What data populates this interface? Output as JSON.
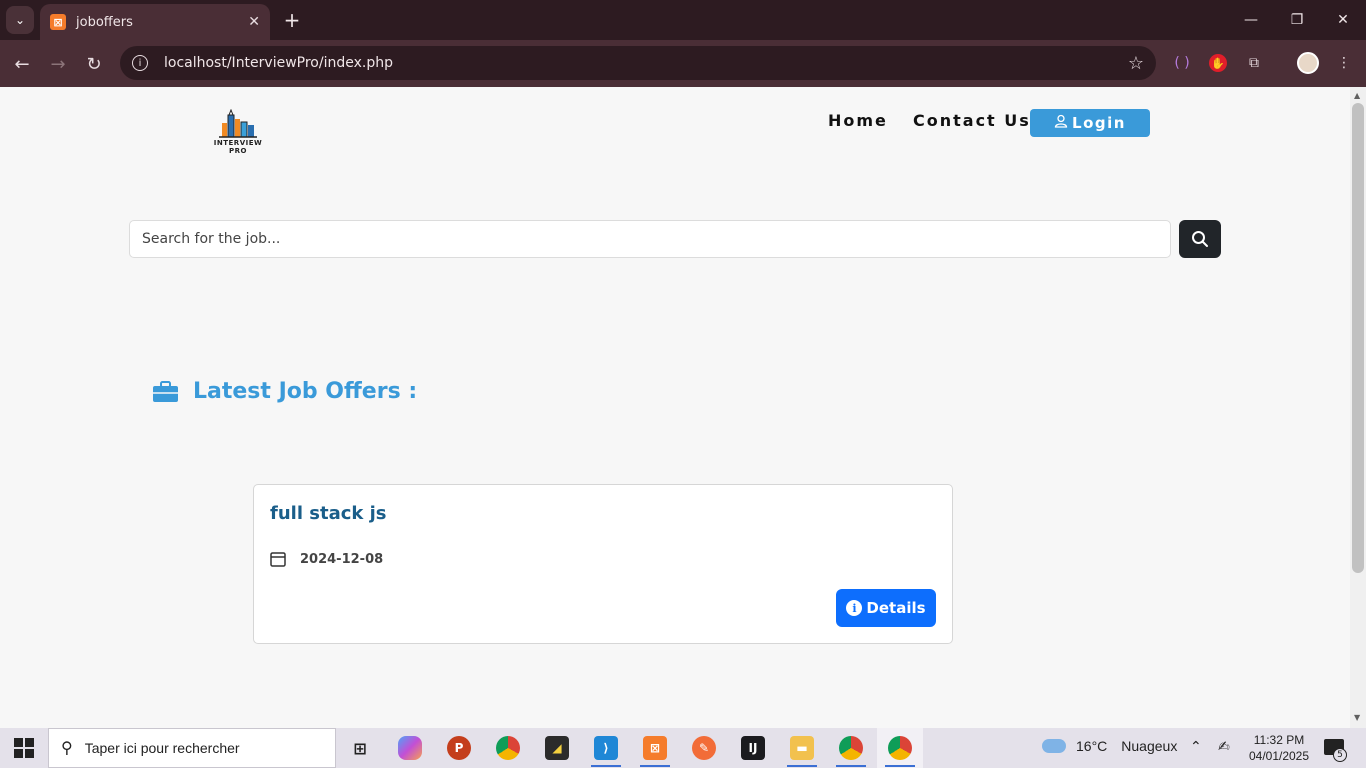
{
  "browser": {
    "tab_title": "joboffers",
    "url": "localhost/InterviewPro/index.php",
    "new_tab_label": "+",
    "close_tab_label": "✕"
  },
  "site": {
    "logo_text": "INTERVIEW PRO",
    "nav": {
      "home": "Home",
      "contact": "Contact Us",
      "login": "Login"
    },
    "search": {
      "placeholder": "Search for the job..."
    },
    "section_title": "Latest Job Offers :",
    "jobs": [
      {
        "title": "full stack js",
        "date": "2024-12-08",
        "details_label": "Details"
      }
    ],
    "colors": {
      "accent": "#3a9ad9",
      "details_button": "#0d6efd",
      "search_button": "#212529",
      "job_title": "#1a5e8a"
    }
  },
  "taskbar": {
    "search_placeholder": "Taper ici pour rechercher",
    "weather": {
      "temp": "16°C",
      "condition": "Nuageux"
    },
    "time": "11:32 PM",
    "date": "04/01/2025",
    "notification_count": "5"
  }
}
